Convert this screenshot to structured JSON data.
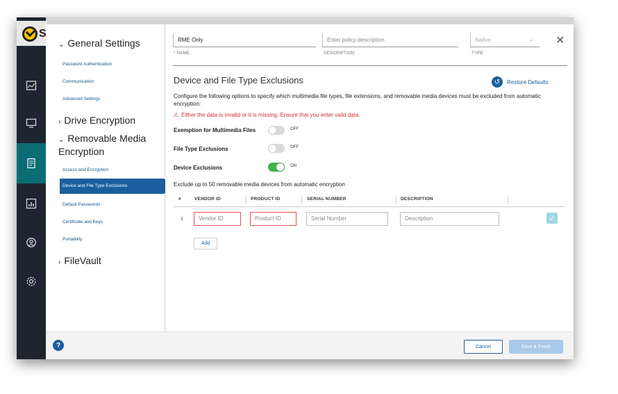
{
  "brand": {
    "logo_text": "S"
  },
  "nav": {
    "general_settings": "General Settings",
    "general_items": [
      "Password Authentication",
      "Communication",
      "Advanced Settings"
    ],
    "drive_encryption": "Drive Encryption",
    "removable_media": "Removable Media Encryption",
    "removable_items": [
      "Access and Encryption",
      "Device and File Type Exclusions",
      "Default Passwords",
      "Certificate and Keys",
      "Portability"
    ],
    "filevault": "FileVault"
  },
  "policy": {
    "name_value": "RME Only",
    "name_label": "* NAME",
    "description_placeholder": "Enter policy description",
    "description_label": "DESCRIPTION",
    "type_value": "Native",
    "type_label": "TYPE"
  },
  "section": {
    "title": "Device and File Type Exclusions",
    "restore_label": "Restore Defaults",
    "description": "Configure the following options to specify which multimedia file types, file extensions, and removable media devices must be excluded from automatic encryption:",
    "error": "Either the data is invalid or it is missing. Ensure that you enter valid data."
  },
  "options": [
    {
      "label": "Exemption for Multimedia Files",
      "state": "OFF"
    },
    {
      "label": "File Type Exclusions",
      "state": "OFF"
    },
    {
      "label": "Device Exclusions",
      "state": "ON"
    }
  ],
  "devices": {
    "note": "Exclude up to 50 removable media devices from automatic encryption",
    "columns": [
      "#",
      "VENDOR ID",
      "PRODUCT ID",
      "SERIAL NUMBER",
      "DESCRIPTION"
    ],
    "row_number": "1",
    "vendor_placeholder": "Vendor ID",
    "product_placeholder": "Product ID",
    "serial_placeholder": "Serial Number",
    "description_placeholder": "Description",
    "add_label": "Add"
  },
  "footer": {
    "help": "?",
    "cancel": "Cancel",
    "save": "Save & Finish"
  },
  "colors": {
    "accent": "#1b5e9e",
    "rail": "#1d2530",
    "rail_active": "#0b6d74",
    "toggle_on": "#3db54a",
    "error": "#d32f2f"
  }
}
